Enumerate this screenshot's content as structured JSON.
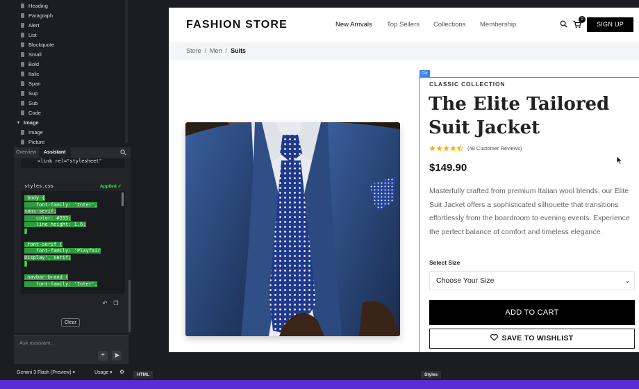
{
  "layers": {
    "items": [
      {
        "label": "Heading"
      },
      {
        "label": "Paragraph"
      },
      {
        "label": "Alert"
      },
      {
        "label": "List"
      },
      {
        "label": "Blockquote"
      },
      {
        "label": "Small"
      },
      {
        "label": "Bold"
      },
      {
        "label": "Italic"
      },
      {
        "label": "Span"
      },
      {
        "label": "Sup"
      },
      {
        "label": "Sub"
      },
      {
        "label": "Code"
      }
    ],
    "group": {
      "label": "Image",
      "items": [
        {
          "label": "Image"
        },
        {
          "label": "Picture"
        }
      ]
    }
  },
  "panel_tabs": {
    "overview": "Overview",
    "assistant": "Assistant"
  },
  "chat": {
    "snippet1": "<link rel=\"stylesheet\"",
    "css_file": "styles.css",
    "applied": "Applied ✓",
    "code_lines": [
      {
        "text": " body {",
        "hl": true
      },
      {
        "text": "    font-family: 'Inter',",
        "hl": true
      },
      {
        "text": "sans-serif;",
        "hl": true
      },
      {
        "text": "    color: #333;",
        "hl": true
      },
      {
        "text": "    line-height: 1.6;",
        "hl": true
      },
      {
        "text": "}",
        "hl": true
      },
      {
        "text": "",
        "hl": false
      },
      {
        "text": ".font-serif {",
        "hl": true
      },
      {
        "text": "    font-family: 'Playfair",
        "hl": true
      },
      {
        "text": "Display', serif;",
        "hl": true
      },
      {
        "text": "}",
        "hl": true
      },
      {
        "text": "",
        "hl": false
      },
      {
        "text": ".navbar-brand {",
        "hl": true
      },
      {
        "text": "    font-family: 'Inter',",
        "hl": true
      }
    ],
    "clear_label": "Clear",
    "input_placeholder": "Ask assistant.."
  },
  "bottom_bar": {
    "model": "Gemini 3 Flash (Preview) ▾",
    "usage": "Usage ▾"
  },
  "stage_tabs": {
    "html": "HTML",
    "styles": "Styles"
  },
  "site": {
    "brand": "FASHION STORE",
    "nav": [
      "New Arrivals",
      "Top Sellers",
      "Collections",
      "Membership"
    ],
    "cart_count": "0",
    "signup": "SIGN UP",
    "breadcrumb": [
      "Store",
      "Men",
      "Suits"
    ],
    "breadcrumb_sep": "/",
    "div_tag": "Div",
    "product": {
      "collection": "CLASSIC COLLECTION",
      "title": "The Elite Tailored Suit Jacket",
      "rating": 4.5,
      "reviews": "(48 Customer Reviews)",
      "price": "$149.90",
      "description": "Masterfully crafted from premium Italian wool blends, our Elite Suit Jacket offers a sophisticated silhouette that transitions effortlessly from the boardroom to evening events. Experience the perfect balance of comfort and timeless elegance.",
      "size_label": "Select Size",
      "size_value": "Choose Your Size",
      "add_to_cart": "ADD TO CART",
      "wishlist": "SAVE TO WISHLIST"
    }
  },
  "colors": {
    "accent_green": "#2f9b3f",
    "selection_blue": "#3a86f0",
    "star_gold": "#f2b400",
    "background_purple": "#5b2bd6"
  }
}
